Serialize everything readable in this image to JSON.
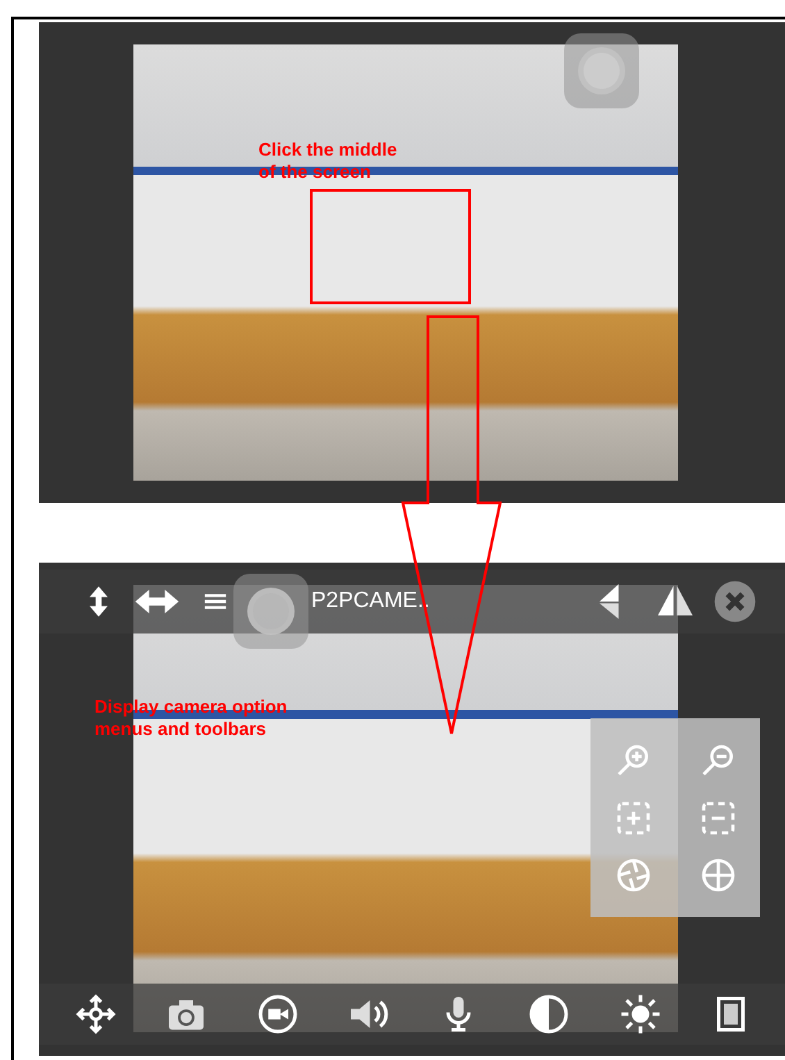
{
  "screen_1": {
    "annotation": "Click the middle of the screen"
  },
  "screen_2": {
    "title": "P2PCAME..",
    "annotation": "Display camera option menus and toolbars"
  }
}
